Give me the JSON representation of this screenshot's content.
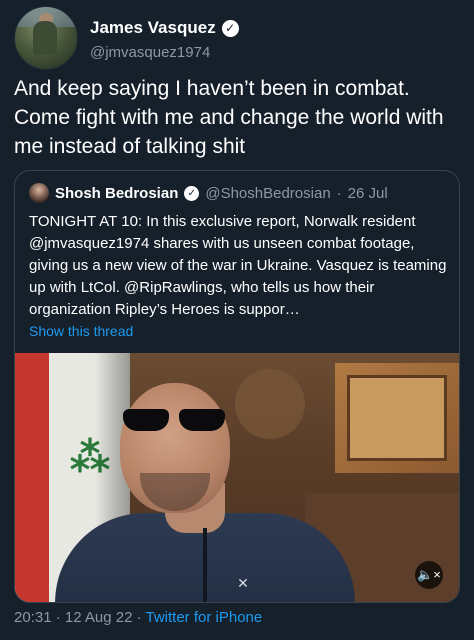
{
  "tweet": {
    "author_name": "James Vasquez",
    "author_handle": "@jmvasquez1974",
    "text": "And keep saying I haven’t been in combat. Come fight with me and change the world with me instead of talking shit",
    "timestamp": "20:31 · 12 Aug 22 · ",
    "source": "Twitter for iPhone"
  },
  "quote": {
    "author_name": "Shosh Bedrosian",
    "author_handle": "@ShoshBedrosian",
    "separator": "·",
    "date": "26 Jul",
    "text": "TONIGHT AT 10: In this exclusive report, Norwalk resident @jmvasquez1974 shares with us unseen combat footage, giving us a new view of the war in Ukraine. Vasquez is teaming up with LtCol. @RipRawlings, who tells us how their organization Ripley’s Heroes is suppor…",
    "show_thread": "Show this thread",
    "media_mute_icon": "🔈×"
  },
  "colors": {
    "background": "#15202b",
    "text_primary": "#ffffff",
    "text_secondary": "#8b98a5",
    "link": "#1d9bf0",
    "border": "#38444d"
  }
}
